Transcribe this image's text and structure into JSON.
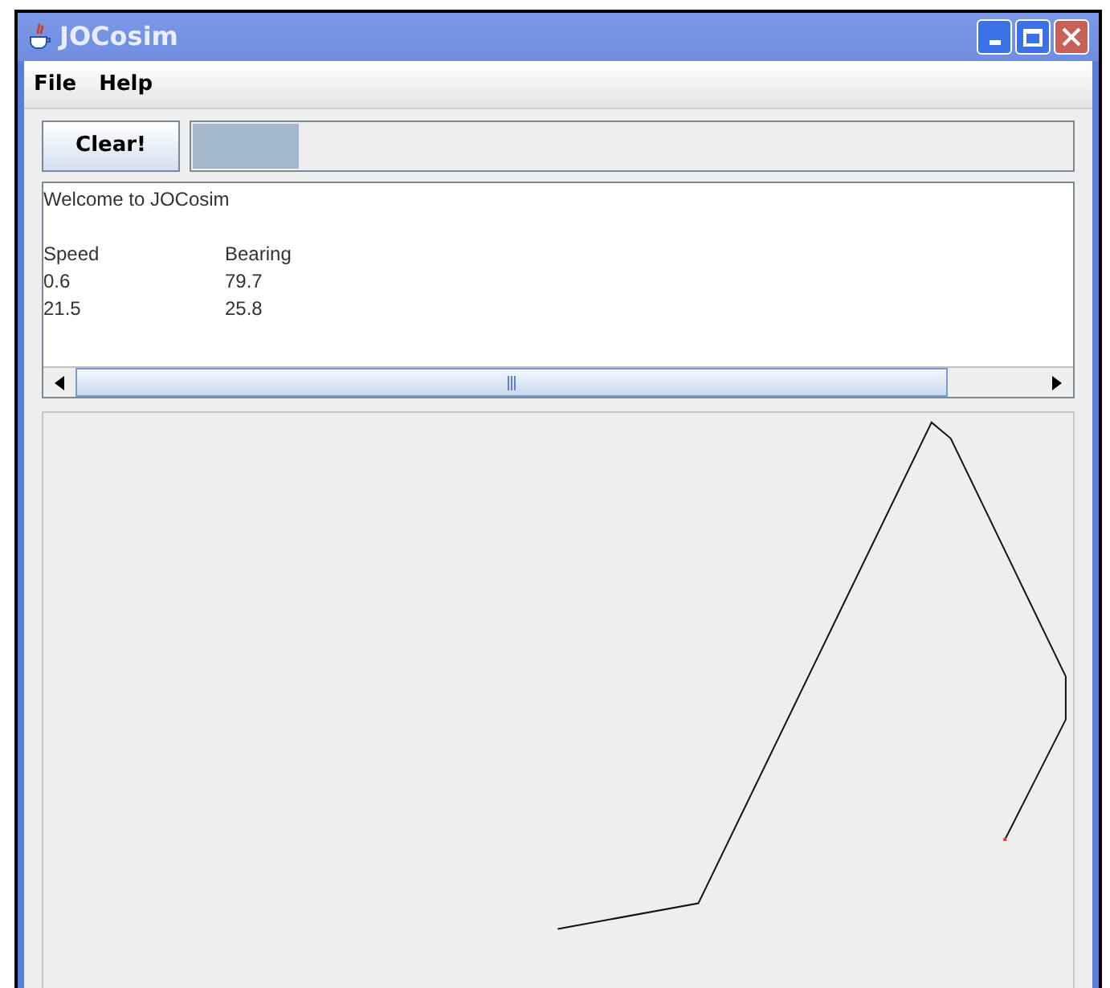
{
  "window": {
    "title": "JOCosim"
  },
  "menu": [
    "File",
    "Help"
  ],
  "toolbar": {
    "button": "Clear!",
    "progress": {
      "level": 0.12
    }
  },
  "output": {
    "lines": [
      "Welcome to JOCosim"
    ],
    "columns": [
      "Speed",
      "Bearing"
    ],
    "rows": [
      [
        "0.6",
        "79.7"
      ],
      [
        "21.5",
        "25.8"
      ]
    ]
  }
}
